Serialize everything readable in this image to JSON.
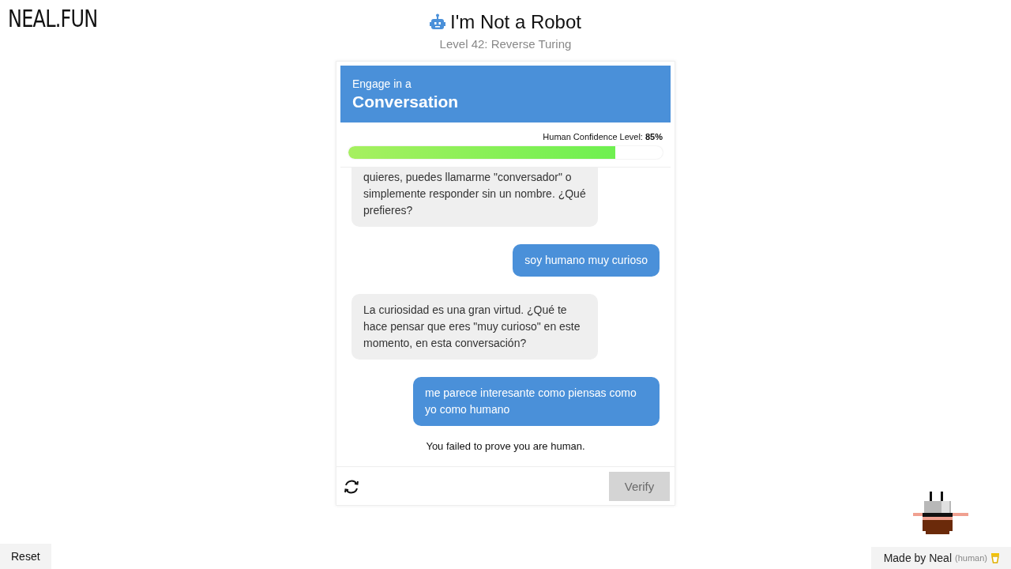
{
  "site_logo": "NEAL.FUN",
  "title": "I'm Not a Robot",
  "subtitle": "Level 42: Reverse Turing",
  "challenge": {
    "intro": "Engage in a",
    "name": "Conversation"
  },
  "confidence": {
    "label": "Human Confidence Level:",
    "value": "85%",
    "level": 0.85
  },
  "messages": [
    {
      "kind": "bot",
      "text": "quieres, puedes llamarme \"conversador\" o simplemente responder sin un nombre. ¿Qué prefieres?",
      "cut_top": true
    },
    {
      "kind": "user",
      "text": "soy humano muy curioso",
      "cut_top": false
    },
    {
      "kind": "bot",
      "text": "La curiosidad es una gran virtud. ¿Qué te hace pensar que eres \"muy curioso\" en este momento, en esta conversación?",
      "cut_top": false
    },
    {
      "kind": "user",
      "text": "me parece interesante como piensas como yo como humano",
      "cut_top": false
    }
  ],
  "result": "You failed to prove you are human.",
  "verify": {
    "label": "Verify",
    "disabled": true
  },
  "reset": "Reset",
  "credit": {
    "by": "Made by Neal",
    "note": "(human)"
  }
}
